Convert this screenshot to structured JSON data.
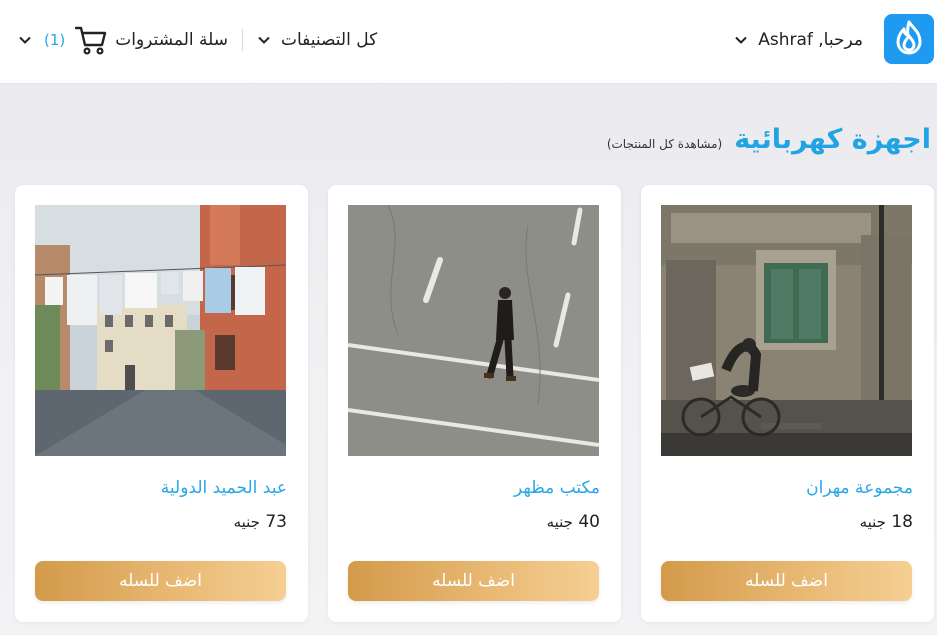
{
  "header": {
    "greeting": "مرحبا, Ashraf",
    "categories_label": "كل التصنيفات",
    "cart_label": "سلة المشتروات",
    "cart_count": "(1)"
  },
  "section": {
    "title": "اجهزة كهربائية",
    "view_all": "(مشاهدة كل المنتجات)"
  },
  "products": [
    {
      "name": "مجموعة مهران",
      "price": "18",
      "currency": "جنيه",
      "button": "اضف للسله",
      "image": "bicycle-building-photo"
    },
    {
      "name": "مكتب مظهر",
      "price": "40",
      "currency": "جنيه",
      "button": "اضف للسله",
      "image": "man-walking-road-photo"
    },
    {
      "name": "عبد الحميد الدولية",
      "price": "73",
      "currency": "جنيه",
      "button": "اضف للسله",
      "image": "laundry-street-photo"
    }
  ],
  "colors": {
    "accent": "#29a6e6",
    "logo_bg": "#1e9af0",
    "button_start": "#d39a4a",
    "button_end": "#f6cf93"
  }
}
